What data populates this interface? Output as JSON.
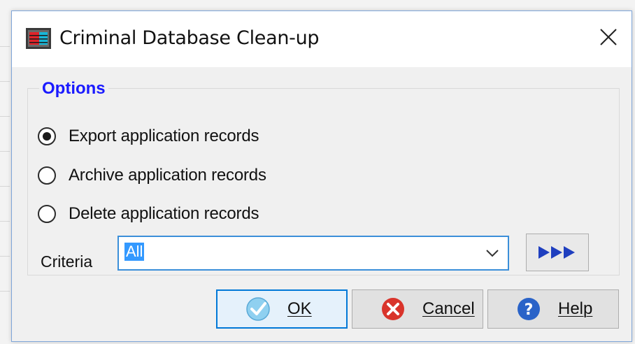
{
  "window": {
    "title": "Criminal Database Clean-up",
    "icon": "database-app-icon",
    "close_icon": "close-icon"
  },
  "options": {
    "group_title": "Options",
    "items": [
      {
        "label": "Export application records",
        "checked": true
      },
      {
        "label": "Archive application records",
        "checked": false
      },
      {
        "label": "Delete application records",
        "checked": false
      }
    ]
  },
  "criteria": {
    "label": "Criteria",
    "value": "All",
    "dropdown_icon": "chevron-down-icon",
    "go_button_icon": "triple-arrow-right-icon"
  },
  "buttons": {
    "ok": {
      "label": "OK",
      "icon": "checkmark-icon"
    },
    "cancel": {
      "label": "Cancel",
      "icon": "cancel-x-icon"
    },
    "help": {
      "label": "Help",
      "icon": "help-question-icon"
    }
  },
  "colors": {
    "accent": "#0078d7",
    "group_title": "#1a1aff",
    "selection": "#3399ff",
    "arrow_blue": "#1f3fbf",
    "cancel_red": "#d9342b",
    "help_blue": "#2a63c8"
  }
}
